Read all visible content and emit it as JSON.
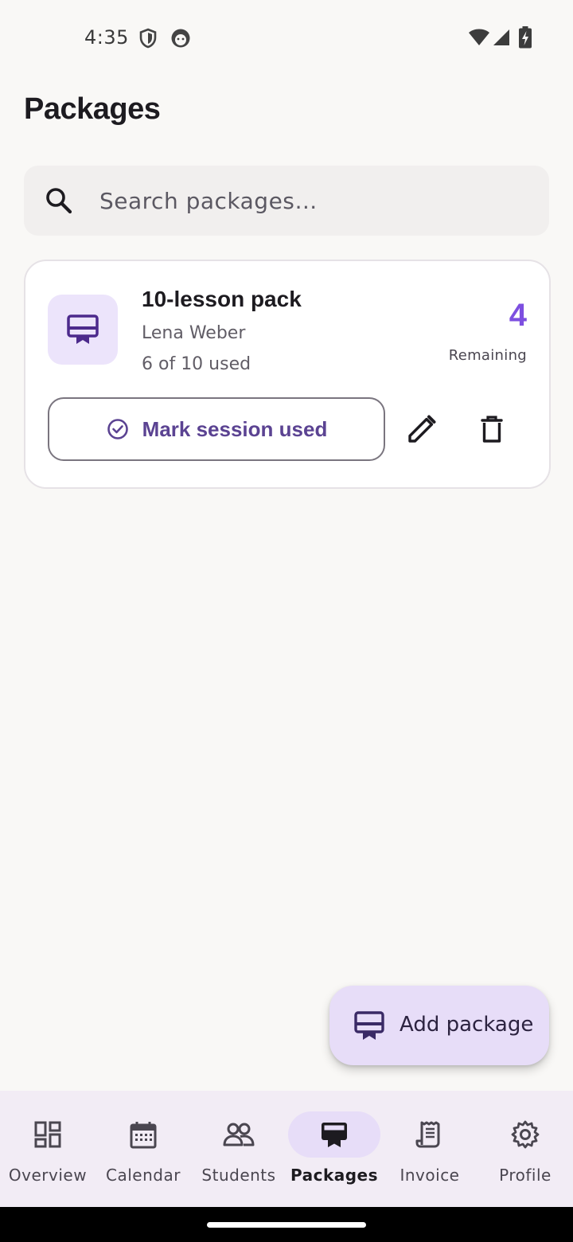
{
  "status_bar": {
    "time": "4:35",
    "icons": [
      "shield-icon",
      "android-face-icon",
      "wifi-icon",
      "signal-icon",
      "battery-charging-icon"
    ]
  },
  "page": {
    "title": "Packages"
  },
  "search": {
    "placeholder": "Search packages…",
    "icon": "search-icon"
  },
  "packages": [
    {
      "icon": "card-membership-icon",
      "name": "10-lesson pack",
      "student": "Lena Weber",
      "usage": "6 of 10 used",
      "remaining_count": "4",
      "remaining_label": "Remaining",
      "mark_used_label": "Mark session used",
      "actions": [
        "edit-icon",
        "delete-icon"
      ]
    }
  ],
  "fab": {
    "label": "Add package",
    "icon": "card-membership-icon"
  },
  "bottom_nav": {
    "active": "Packages",
    "items": [
      {
        "label": "Overview",
        "icon": "dashboard-icon"
      },
      {
        "label": "Calendar",
        "icon": "calendar-icon"
      },
      {
        "label": "Students",
        "icon": "people-icon"
      },
      {
        "label": "Packages",
        "icon": "card-membership-icon"
      },
      {
        "label": "Invoice",
        "icon": "receipt-icon"
      },
      {
        "label": "Profile",
        "icon": "gear-icon"
      }
    ]
  },
  "colors": {
    "background": "#f9f8f6",
    "accent": "#7d4fe0",
    "primary_text": "#5b4392",
    "fab_bg": "#e7ddf8",
    "nav_bg": "#f2ecf5"
  }
}
